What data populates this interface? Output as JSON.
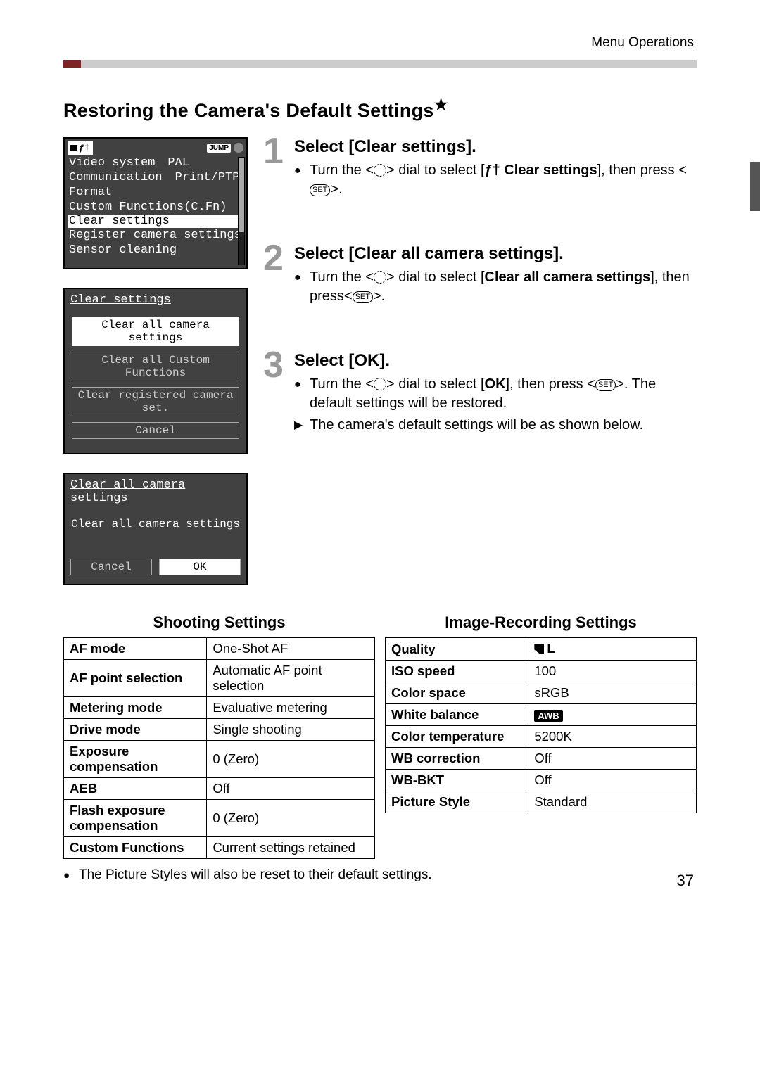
{
  "header": "Menu Operations",
  "section_title": "Restoring the Camera's Default Settings",
  "star": "★",
  "screen1": {
    "jump": "JUMP",
    "items": [
      {
        "label": "Video system",
        "value": "PAL"
      },
      {
        "label": "Communication",
        "value": "Print/PTP"
      },
      {
        "label": "Format",
        "value": ""
      },
      {
        "label": "Custom Functions(C.Fn)",
        "value": ""
      },
      {
        "label": "Clear settings",
        "value": "",
        "highlight": true
      },
      {
        "label": "Register camera settings",
        "value": ""
      },
      {
        "label": "Sensor cleaning",
        "value": ""
      }
    ]
  },
  "screen2": {
    "title": "Clear settings",
    "options": [
      {
        "label": "Clear all camera settings",
        "selected": true
      },
      {
        "label": "Clear all Custom Functions"
      },
      {
        "label": "Clear registered camera set."
      },
      {
        "label": "Cancel"
      }
    ]
  },
  "screen3": {
    "title": "Clear all camera settings",
    "message": "Clear all camera settings",
    "cancel": "Cancel",
    "ok": "OK"
  },
  "steps": [
    {
      "num": "1",
      "title": "Select [Clear settings].",
      "body_pre": "Turn the <",
      "body_mid": "> dial to select [",
      "body_bold": "Clear settings",
      "body_after": "], then press <",
      "body_end": ">."
    },
    {
      "num": "2",
      "title": "Select [Clear all camera settings].",
      "body_pre": "Turn the <",
      "body_mid": "> dial to select [",
      "body_bold": "Clear all camera settings",
      "body_after": "], then press<",
      "body_end": ">."
    },
    {
      "num": "3",
      "title": "Select [OK].",
      "body_pre": "Turn the <",
      "body_mid": "> dial to select [",
      "body_bold": "OK",
      "body_after": "], then press <",
      "body_end": ">. The default settings will be restored.",
      "extra": "The camera's default settings will be as shown below."
    }
  ],
  "table_left_title": "Shooting Settings",
  "table_right_title": "Image-Recording Settings",
  "table_left": [
    {
      "k": "AF mode",
      "v": "One-Shot AF"
    },
    {
      "k": "AF point selection",
      "v": "Automatic AF point selection"
    },
    {
      "k": "Metering mode",
      "v": "Evaluative metering"
    },
    {
      "k": "Drive mode",
      "v": "Single shooting"
    },
    {
      "k": "Exposure compensation",
      "v": "0 (Zero)"
    },
    {
      "k": "AEB",
      "v": "Off"
    },
    {
      "k": "Flash exposure compensation",
      "v": "0 (Zero)"
    },
    {
      "k": "Custom Functions",
      "v": "Current settings retained"
    }
  ],
  "table_right": [
    {
      "k": "Quality",
      "v": "L",
      "icon": "quality"
    },
    {
      "k": "ISO speed",
      "v": "100"
    },
    {
      "k": "Color space",
      "v": "sRGB"
    },
    {
      "k": "White balance",
      "v": "AWB",
      "icon": "awb"
    },
    {
      "k": "Color temperature",
      "v": "5200K"
    },
    {
      "k": "WB correction",
      "v": "Off"
    },
    {
      "k": "WB-BKT",
      "v": "Off"
    },
    {
      "k": "Picture Style",
      "v": "Standard"
    }
  ],
  "foot_note": "The Picture Styles will also be reset to their default settings.",
  "page_number": "37"
}
